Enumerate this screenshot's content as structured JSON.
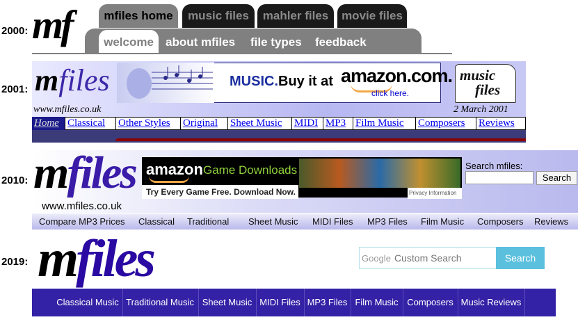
{
  "years": {
    "y2000": "2000:",
    "y2001": "2001:",
    "y2010": "2010:",
    "y2019": "2019:"
  },
  "site2000": {
    "logo": "mf",
    "top_tabs": [
      {
        "label": "mfiles home",
        "active": true
      },
      {
        "label": "music files",
        "active": false
      },
      {
        "label": "mahler files",
        "active": false
      },
      {
        "label": "movie files",
        "active": false
      }
    ],
    "sub_tabs": [
      {
        "label": "welcome",
        "active": true
      },
      {
        "label": "about mfiles",
        "active": false
      },
      {
        "label": "file types",
        "active": false
      },
      {
        "label": "feedback",
        "active": false
      }
    ]
  },
  "site2001": {
    "logo_m": "m",
    "logo_rest": "files",
    "url": "www.mfiles.co.uk",
    "date": "2 March 2001",
    "banner": {
      "music": "MUSIC.",
      "buy": "Buy it at",
      "amazon": "amazon.com.",
      "click": "click here."
    },
    "music_files_logo": {
      "line1": "music",
      "line2": "files"
    },
    "nav": [
      "Home",
      "Classical",
      "Other Styles",
      "Original",
      "Sheet Music",
      "MIDI",
      "MP3",
      "Film Music",
      "Composers",
      "Reviews"
    ]
  },
  "site2010": {
    "logo_m": "m",
    "logo_rest": "files",
    "url": "www.mfiles.co.uk",
    "ad": {
      "amazon": "amazon",
      "game": "Game Downloads",
      "try": "Try Every Game Free. Download Now.",
      "privacy": "Privacy Information"
    },
    "search_label": "Search mfiles:",
    "search_button": "Search",
    "nav": [
      "Compare MP3 Prices",
      "Classical",
      "Traditional",
      "Sheet Music",
      "MIDI Files",
      "MP3 Files",
      "Film Music",
      "Composers",
      "Reviews"
    ]
  },
  "site2019": {
    "logo_m": "m",
    "logo_rest": "files",
    "search_brand": "Google",
    "search_placeholder": "Custom Search",
    "search_button": "Search",
    "nav": [
      "Classical Music",
      "Traditional Music",
      "Sheet Music",
      "MIDI Files",
      "MP3 Files",
      "Film Music",
      "Composers",
      "Music Reviews"
    ]
  }
}
